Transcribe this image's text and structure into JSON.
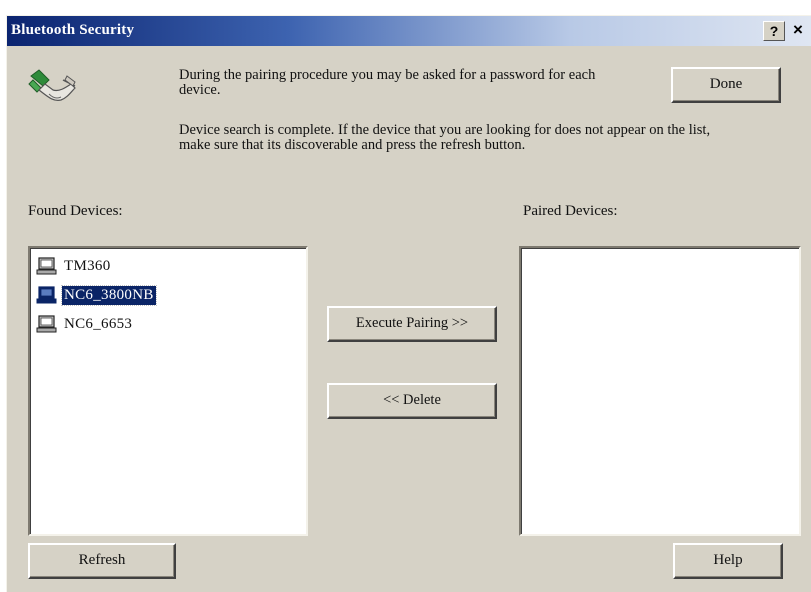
{
  "window": {
    "title": "Bluetooth Security",
    "help_glyph": "?",
    "close_glyph": "×"
  },
  "header": {
    "icon": "bluetooth-handshake-icon",
    "message_pairing": "During the pairing procedure you may be asked for a password for each device.",
    "message_search": "Device search is complete. If the device that you are looking for does not appear on the list, make sure that its discoverable and press the refresh button."
  },
  "found_devices": {
    "label": "Found Devices:",
    "items": [
      {
        "name": "TM360",
        "icon": "computer-icon",
        "selected": false
      },
      {
        "name": "NC6_3800NB",
        "icon": "computer-icon",
        "selected": true
      },
      {
        "name": "NC6_6653",
        "icon": "computer-icon",
        "selected": false
      }
    ]
  },
  "paired_devices": {
    "label": "Paired Devices:",
    "items": []
  },
  "buttons": {
    "done": "Done",
    "execute_pairing": "Execute Pairing >>",
    "delete": "<< Delete",
    "refresh": "Refresh",
    "help": "Help"
  },
  "colors": {
    "dialog_face": "#d6d2c6",
    "title_start": "#0b2470",
    "selection": "#0a2466"
  }
}
